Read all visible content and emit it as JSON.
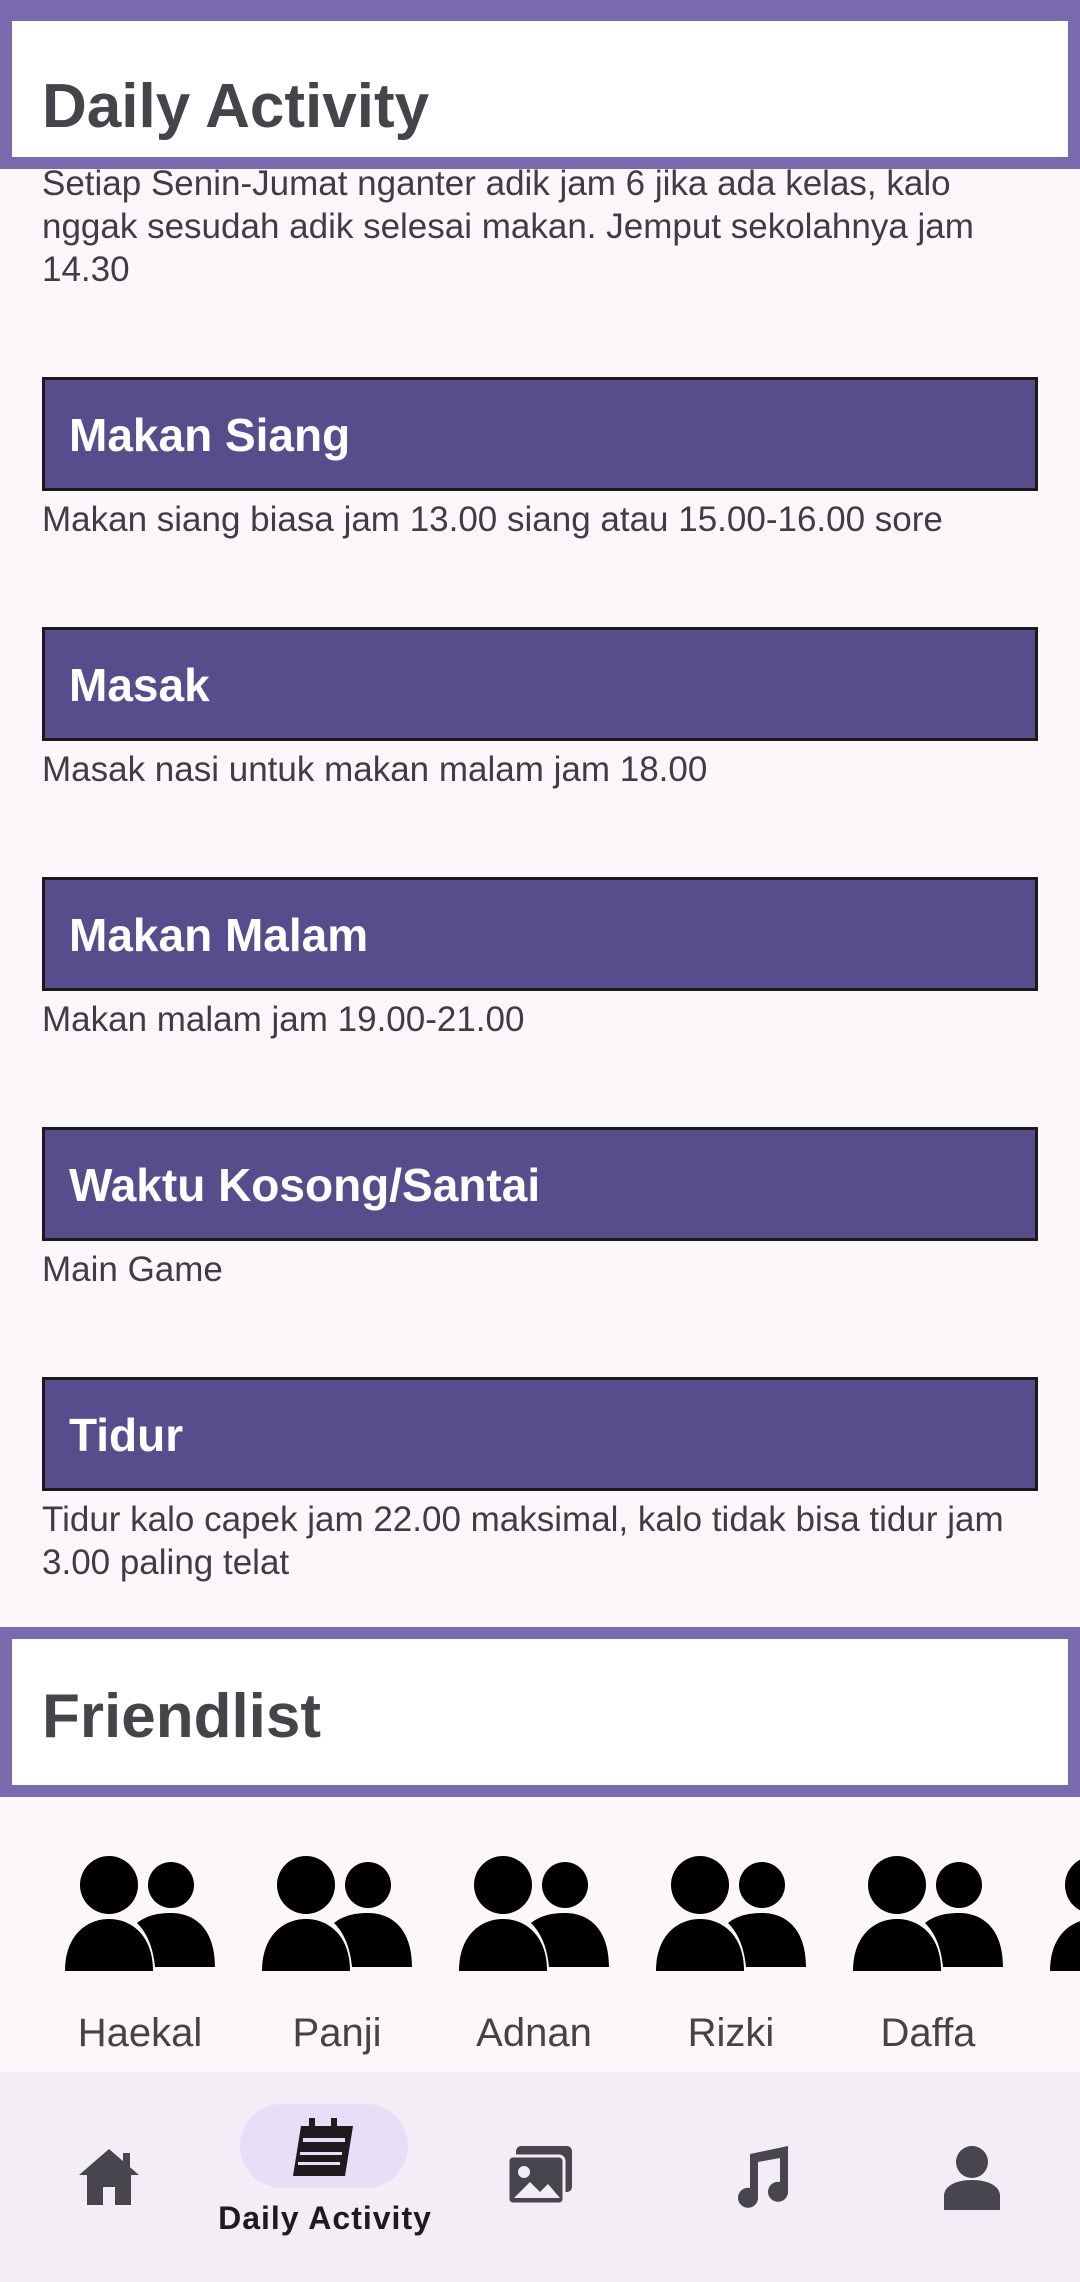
{
  "daily_activity": {
    "title": "Daily Activity",
    "intro_text": "Setiap Senin-Jumat nganter adik jam 6 jika ada kelas, kalo nggak sesudah adik selesai makan. Jemput sekolahnya jam 14.30",
    "items": [
      {
        "title": "Makan Siang",
        "desc": "Makan siang biasa jam 13.00 siang atau 15.00-16.00 sore"
      },
      {
        "title": "Masak",
        "desc": "Masak nasi untuk makan malam jam 18.00"
      },
      {
        "title": "Makan Malam",
        "desc": "Makan malam jam 19.00-21.00"
      },
      {
        "title": "Waktu Kosong/Santai",
        "desc": "Main Game"
      },
      {
        "title": "Tidur",
        "desc": "Tidur kalo capek jam 22.00 maksimal, kalo tidak bisa tidur jam 3.00 paling telat"
      }
    ]
  },
  "friendlist": {
    "title": "Friendlist",
    "friends": [
      {
        "name": "Haekal",
        "icon": "group-icon"
      },
      {
        "name": "Panji",
        "icon": "group-icon"
      },
      {
        "name": "Adnan",
        "icon": "group-icon"
      },
      {
        "name": "Rizki",
        "icon": "group-icon"
      },
      {
        "name": "Daffa",
        "icon": "group-icon"
      }
    ]
  },
  "bottom_nav": {
    "items": [
      {
        "icon": "home-icon",
        "label": ""
      },
      {
        "icon": "calendar-icon",
        "label": "Daily Activity",
        "selected": true
      },
      {
        "icon": "gallery-icon",
        "label": ""
      },
      {
        "icon": "music-icon",
        "label": ""
      },
      {
        "icon": "person-icon",
        "label": ""
      }
    ],
    "active_color": "#e8def8"
  },
  "colors": {
    "accent": "#7a6aae",
    "activity_bar": "#584d8c",
    "background": "#fdf7fb"
  }
}
